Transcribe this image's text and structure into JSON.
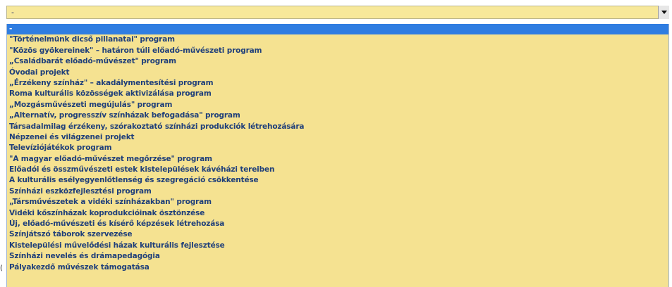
{
  "dropdown": {
    "selected_value": "-",
    "options": [
      "-",
      "\"Történelmünk dicső pillanatai\" program",
      "\"Közös gyökereinek\" – határon túli előadó-művészeti program",
      "„Családbarát előadó-művészet\" program",
      "Óvodai projekt",
      "„Érzékeny színház\" – akadálymentesítési program",
      "Roma kulturális közösségek aktivizálása program",
      "„Mozgásművészeti megújulás\" program",
      "„Alternatív, progresszív színházak befogadása\" program",
      "Társadalmilag érzékeny, szórakoztató színházi produkciók létrehozására",
      "Népzenei és világzenei projekt",
      "Televíziójátékok program",
      "\"A magyar előadó-művészet megőrzése\" program",
      "Előadói és összművészeti estek kistelepülések kávéházi tereiben",
      "A kulturális esélyegyenlőtlenség és szegregáció csökkentése",
      "Színházi eszközfejlesztési program",
      "„Társművészetek a vidéki színházakban\" program",
      "Vidéki kőszínházak koprodukcióinak ösztönzése",
      "Új, előadó-művészeti és kísérő képzések létrehozása",
      "Színjátszó táborok szervezése",
      "Kistelepülési művelődési házak kulturális fejlesztése",
      "Színházi nevelés és drámapedagógia",
      "Pályakezdő művészek támogatása"
    ]
  },
  "partial_text": "("
}
